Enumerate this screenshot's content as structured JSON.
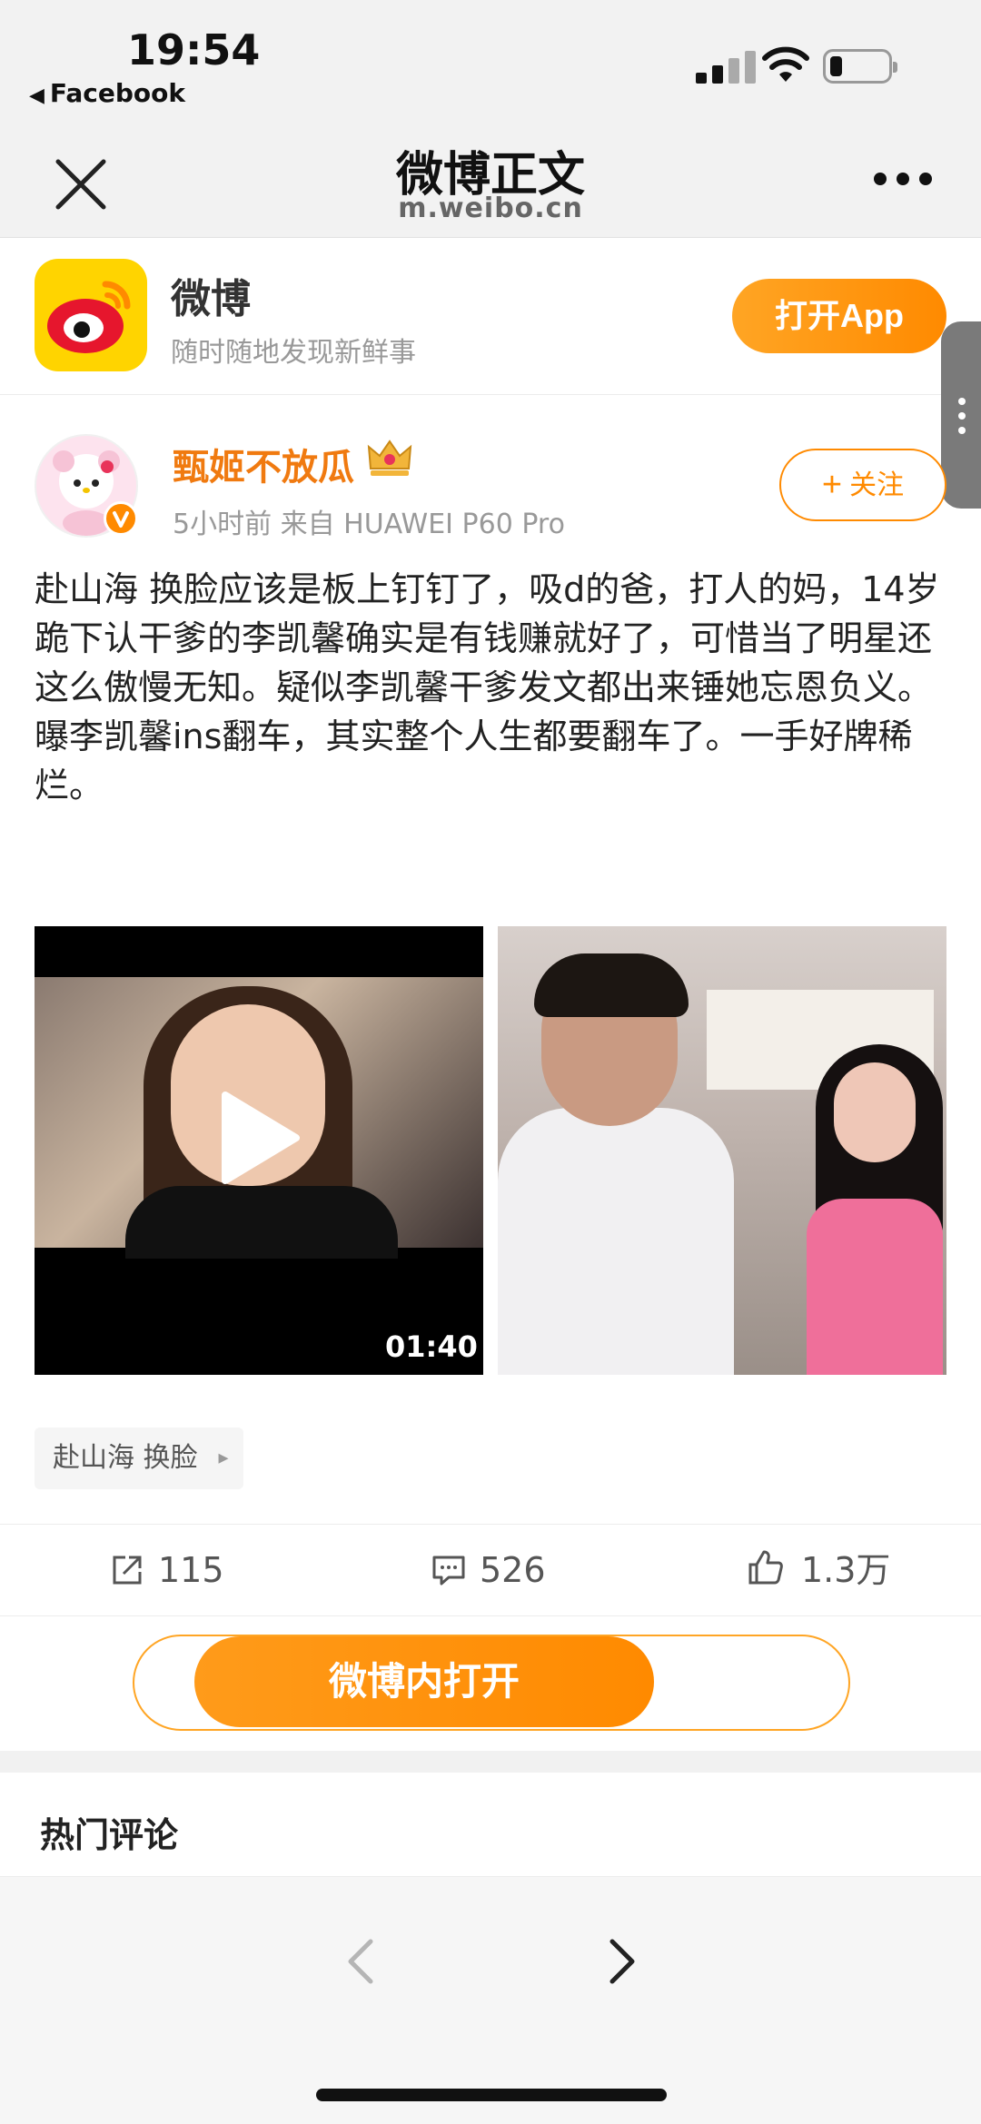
{
  "status_bar": {
    "time": "19:54",
    "back_app": "Facebook",
    "battery_level": 0.2
  },
  "nav": {
    "title": "微博正文",
    "subtitle": "m.weibo.cn"
  },
  "banner": {
    "app_name": "微博",
    "slogan": "随时随地发现新鲜事",
    "open_app_label": "打开App"
  },
  "post": {
    "username": "甄姬不放瓜",
    "meta": "5小时前  来自 HUAWEI P60 Pro",
    "follow_label": "关注",
    "text_lines": [
      "赴山海 换脸应该是板上钉钉了，吸d的爸，打人的妈，14岁跪下认干爹的李凯馨确实是有钱赚就好了，可惜当了明星还这么傲慢无知。疑似李凯馨干爹发文都出来锤她忘恩负义。",
      "曝李凯馨ins翻车，其实整个人生都要翻车了。一手好牌稀烂。"
    ],
    "video_duration": "01:40",
    "topic": "赴山海 换脸"
  },
  "actions": {
    "share_count": "115",
    "comment_count": "526",
    "like_count": "1.3万"
  },
  "open_in_weibo_label": "微博内打开",
  "comments": {
    "heading": "热门评论"
  },
  "colors": {
    "accent": "#ff8a00",
    "username": "#f07a10",
    "logo_bg": "#ffd400"
  }
}
